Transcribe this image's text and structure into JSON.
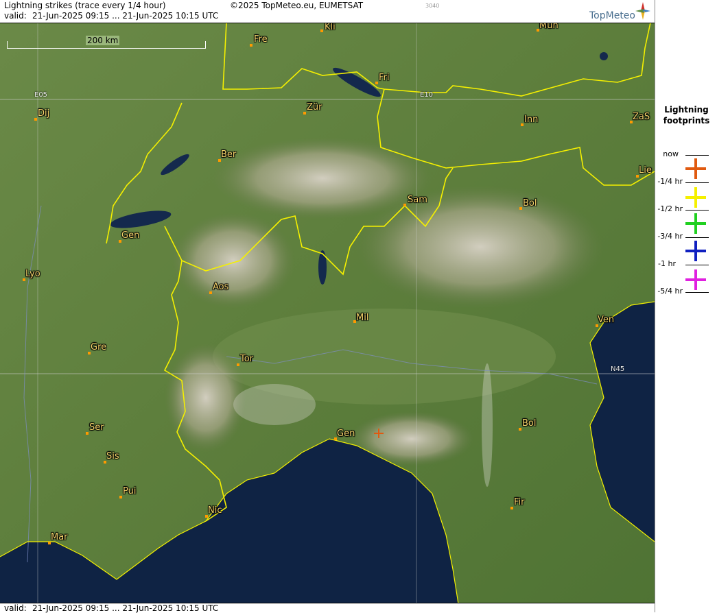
{
  "header": {
    "title": "Lightning strikes (trace every 1/4 hour)",
    "valid_label": "valid:",
    "valid_range": "21-Jun-2025 09:15 ... 21-Jun-2025 10:15 UTC",
    "copyright": "©2025 TopMeteo.eu, EUMETSAT",
    "code": "3040",
    "logo_text": "TopMeteo"
  },
  "footer": {
    "valid_label": "valid:",
    "valid_range": "21-Jun-2025 09:15 ... 21-Jun-2025 10:15 UTC"
  },
  "scale": {
    "label": "200 km"
  },
  "grid_labels": [
    "E05",
    "E10",
    "N45"
  ],
  "cities": [
    "Kli",
    "Mün",
    "Fre",
    "Fri",
    "Dij",
    "Zür",
    "Inn",
    "ZaS",
    "Ber",
    "Lie",
    "Sam",
    "Bol",
    "Gen",
    "Lyo",
    "Aos",
    "Mil",
    "Ven",
    "Gre",
    "Tor",
    "Ser",
    "Gen",
    "Bol",
    "Sis",
    "Pui",
    "Nic",
    "Fir",
    "Mar"
  ],
  "legend": {
    "title_line1": "Lightning",
    "title_line2": "footprints",
    "entries": [
      {
        "label": "now",
        "color": "#e05a10"
      },
      {
        "label": "-1/4 hr",
        "color": "#f5f000"
      },
      {
        "label": "-1/2 hr",
        "color": "#20d020"
      },
      {
        "label": "-3/4 hr",
        "color": "#1020c0"
      },
      {
        "label": "-1 hr",
        "color": "#e020e0"
      },
      {
        "label": "-5/4 hr",
        "color": ""
      }
    ]
  },
  "strikes": [
    {
      "age": "now",
      "color": "#e05a10"
    }
  ],
  "colors": {
    "sea": "#0d1f3f",
    "land": "#5f8240",
    "border": "#f5f000",
    "city_label": "#f3d36a"
  }
}
